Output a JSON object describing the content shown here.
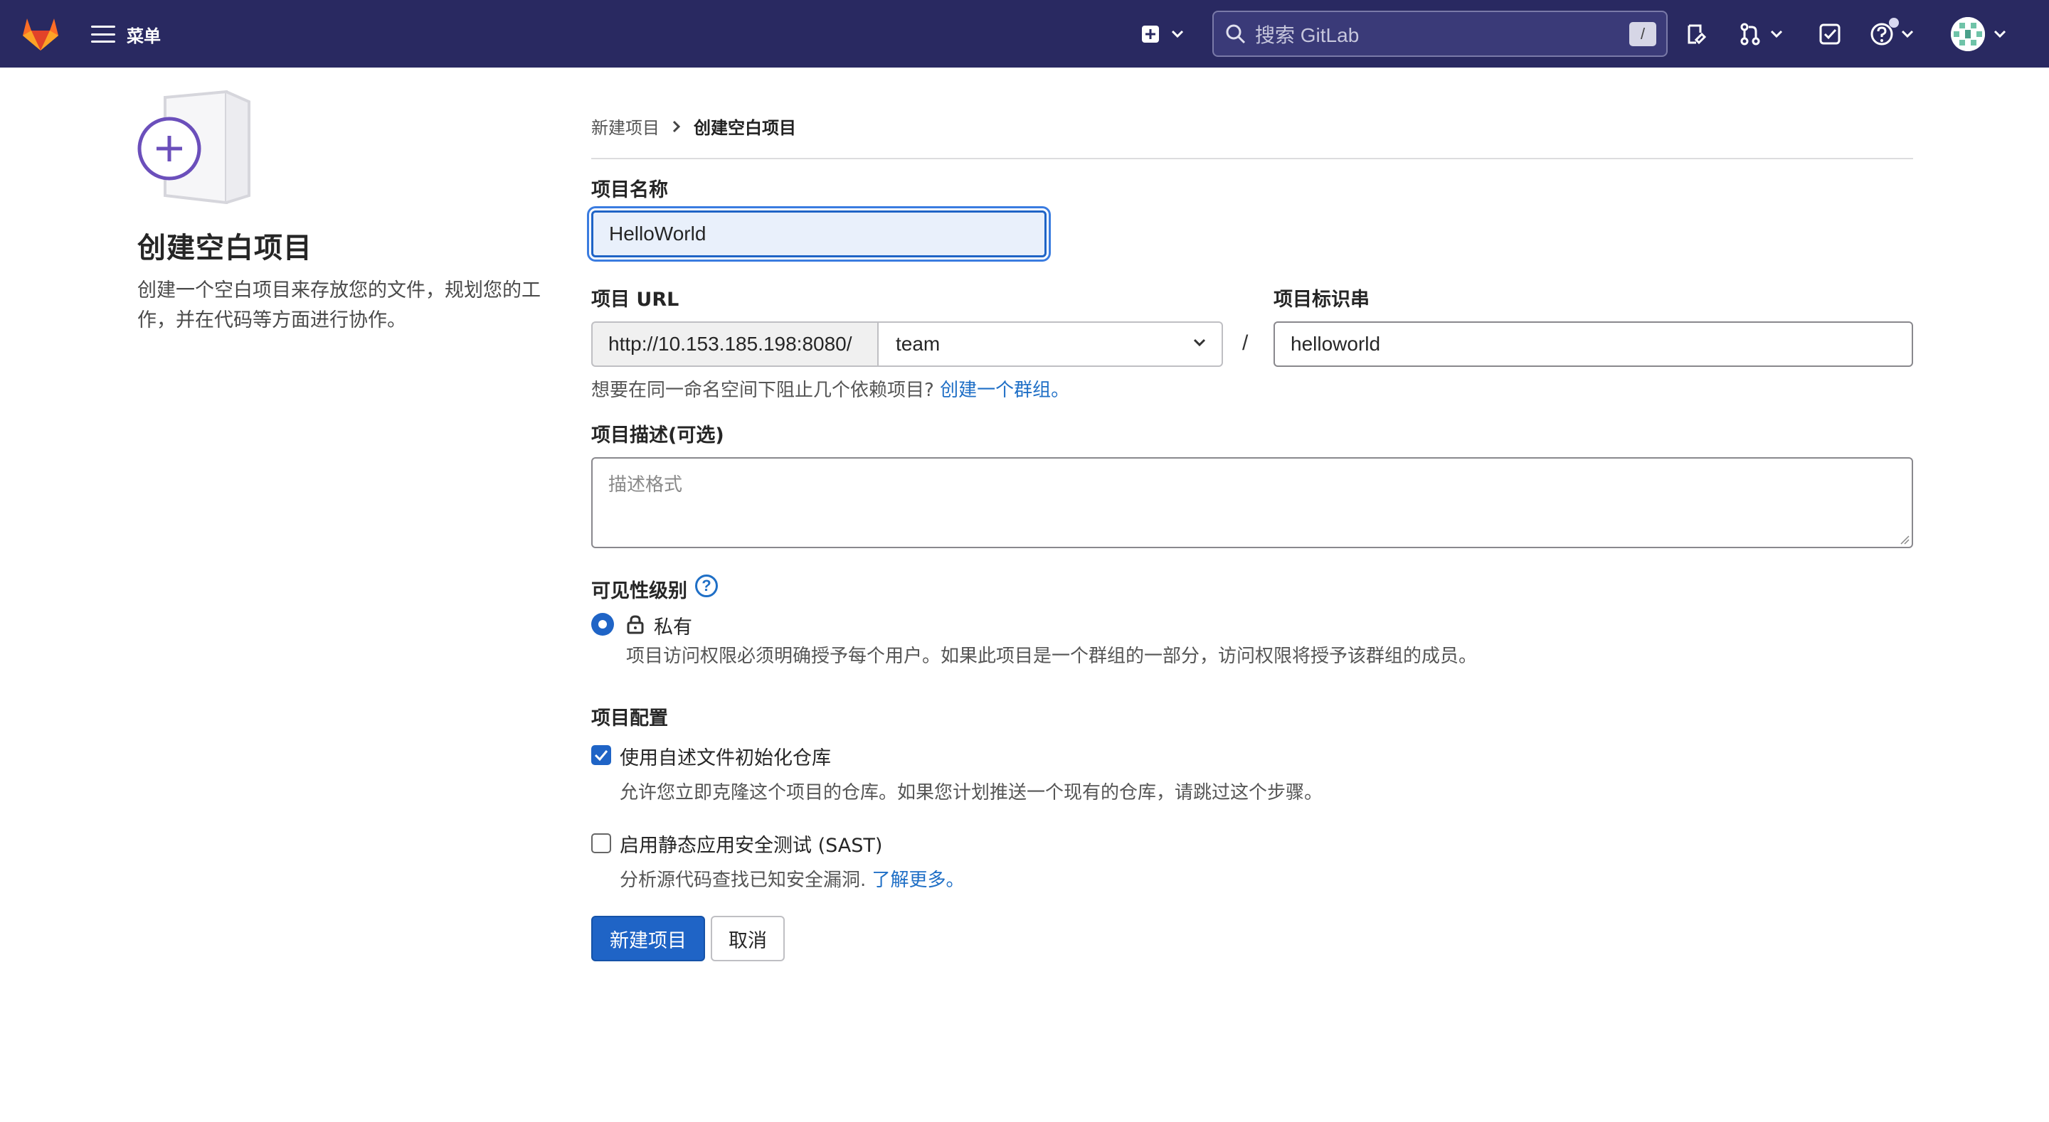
{
  "navbar": {
    "menu_label": "菜单",
    "search_placeholder": "搜索 GitLab",
    "search_shortcut": "/",
    "icons": [
      "gitlab-logo-icon",
      "hamburger-icon",
      "new-item-icon",
      "chevron-down-icon",
      "search-icon",
      "issues-icon",
      "merge-request-icon",
      "todo-icon",
      "help-icon",
      "avatar"
    ]
  },
  "sidebar": {
    "title": "创建空白项目",
    "description": "创建一个空白项目来存放您的文件，规划您的工作，并在代码等方面进行协作。"
  },
  "breadcrumb": {
    "items": [
      "新建项目",
      "创建空白项目"
    ]
  },
  "form": {
    "project_name_label": "项目名称",
    "project_name_value": "HelloWorld",
    "project_url_label": "项目 URL",
    "url_prefix": "http://10.153.185.198:8080/",
    "namespace_value": "team",
    "slash": "/",
    "slug_label": "项目标识串",
    "slug_value": "helloworld",
    "group_hint": "想要在同一命名空间下阻止几个依赖项目?",
    "group_link": "创建一个群组。",
    "description_label": "项目描述(可选)",
    "description_placeholder": "描述格式",
    "visibility_label": "可见性级别",
    "visibility_help": "?",
    "visibility_option": "私有",
    "visibility_option_desc": "项目访问权限必须明确授予每个用户。如果此项目是一个群组的一部分，访问权限将授予该群组的成员。",
    "config_label": "项目配置",
    "readme_label": "使用自述文件初始化仓库",
    "readme_checked": true,
    "readme_desc": "允许您立即克隆这个项目的仓库。如果您计划推送一个现有的仓库，请跳过这个步骤。",
    "sast_label": "启用静态应用安全测试 (SAST)",
    "sast_checked": false,
    "sast_desc": "分析源代码查找已知安全漏洞.",
    "sast_link": "了解更多。",
    "submit_label": "新建项目",
    "cancel_label": "取消"
  },
  "colors": {
    "navbar_bg": "#292961",
    "primary": "#1f64c6",
    "link": "#1f6fc6",
    "accent_purple": "#6b4fbb",
    "logo_orange": "#e24329"
  }
}
